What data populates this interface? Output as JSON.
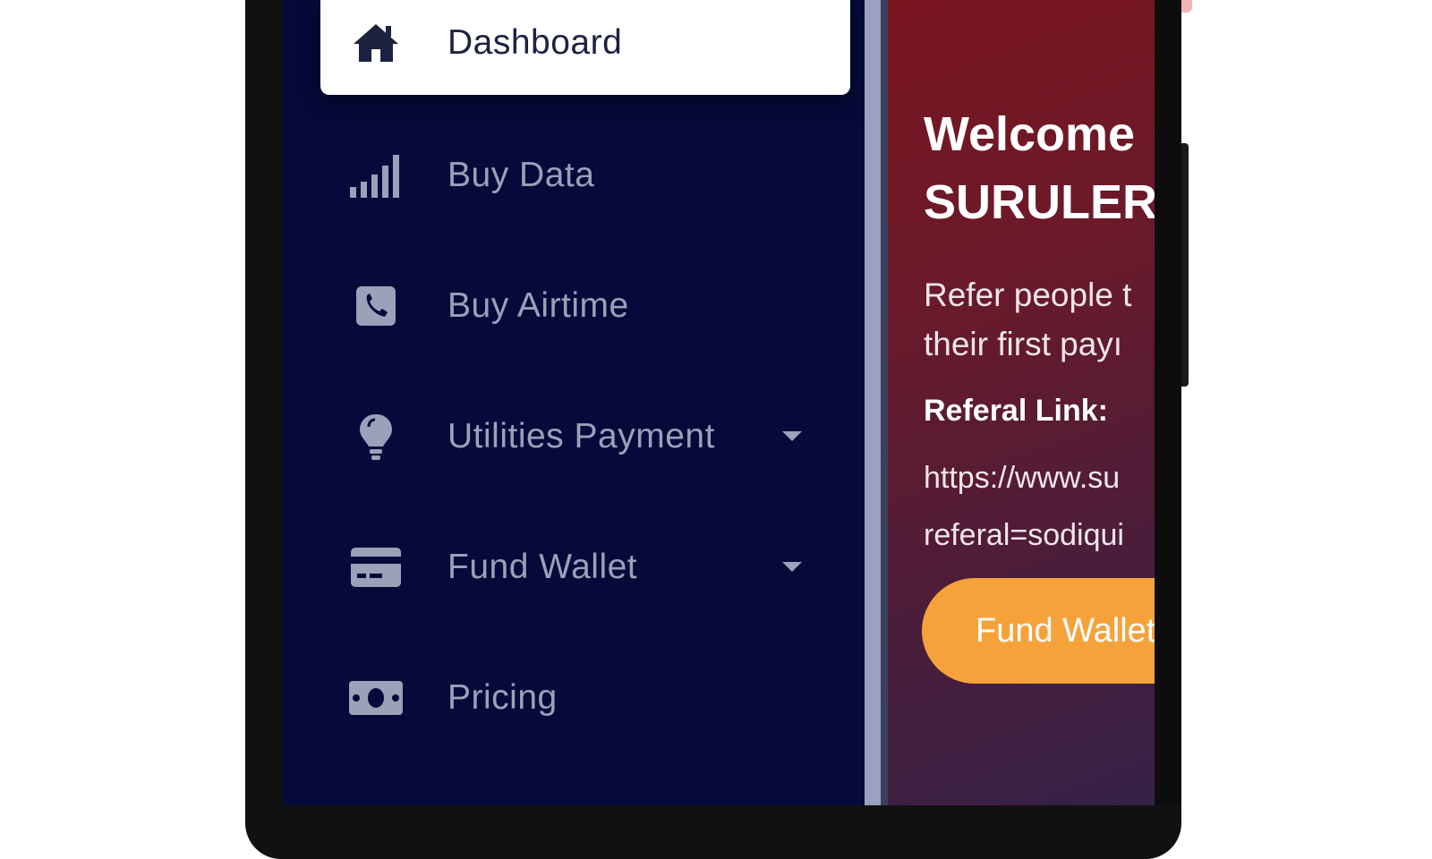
{
  "sidebar": {
    "items": [
      {
        "label": "Dashboard",
        "icon": "home-icon",
        "active": true
      },
      {
        "label": "Buy Data",
        "icon": "signal-bars-icon"
      },
      {
        "label": "Buy Airtime",
        "icon": "phone-square-icon"
      },
      {
        "label": "Utilities Payment",
        "icon": "lightbulb-icon",
        "has_dropdown": true
      },
      {
        "label": "Fund Wallet",
        "icon": "credit-card-icon",
        "has_dropdown": true
      },
      {
        "label": "Pricing",
        "icon": "money-bill-icon"
      }
    ]
  },
  "main": {
    "welcome_line1": "Welcome",
    "welcome_line2": "SURULERE",
    "refer_line1": "Refer people t",
    "refer_line2": "their first payı",
    "referral_label": "Referal Link:",
    "referral_link_line1": "https://www.su",
    "referral_link_line2": "referal=sodiqui",
    "fund_wallet_button": "Fund Wallet"
  },
  "colors": {
    "sidebar_bg": "#060a3a",
    "main_gradient_start": "#7a1520",
    "main_gradient_end": "#352146",
    "button_accent": "#f6a23a"
  }
}
